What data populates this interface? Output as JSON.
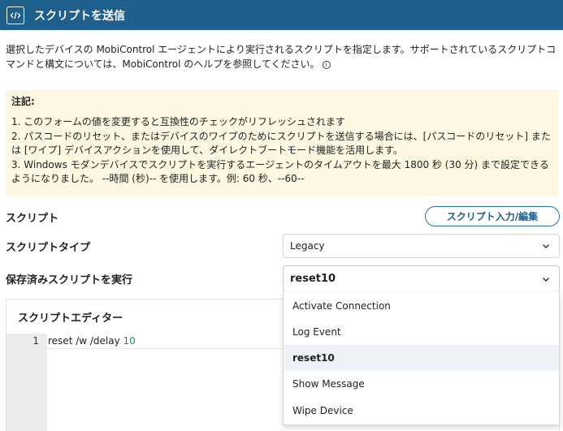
{
  "header": {
    "title": "スクリプトを送信",
    "icon": "script-code-icon",
    "color": "#1f5f8b"
  },
  "description": "選択したデバイスの MobiControl エージェントにより実行されるスクリプトを指定します。サポートされているスクリプトコマンドと構文については、MobiControl のヘルプを参照してください。",
  "note": {
    "title": "注記:",
    "items": [
      "1. このフォームの値を変更すると互換性のチェックがリフレッシュされます",
      "2. パスコードのリセット、またはデバイスのワイプのためにスクリプトを送信する場合には、[パスコードのリセット] または [ワイプ] デバイスアクションを使用して、ダイレクトブートモード機能を活用します。",
      "3. Windows モダンデバイスでスクリプトを実行するエージェントのタイムアウトを最大 1800 秒 (30 分) まで設定できるようになりました。 --時間 (秒)-- を使用します。例: 60 秒、--60--"
    ]
  },
  "script": {
    "label": "スクリプト",
    "edit_button": "スクリプト入力/編集"
  },
  "script_type": {
    "label": "スクリプトタイプ",
    "value": "Legacy"
  },
  "saved_script": {
    "label": "保存済みスクリプトを実行",
    "value": "reset10",
    "options": [
      "Activate Connection",
      "Log Event",
      "reset10",
      "Show Message",
      "Wipe Device"
    ],
    "selected_index": 2
  },
  "editor": {
    "title": "スクリプトエディター",
    "line_number": "1",
    "code_text": "reset /w /delay ",
    "code_number": "10"
  }
}
